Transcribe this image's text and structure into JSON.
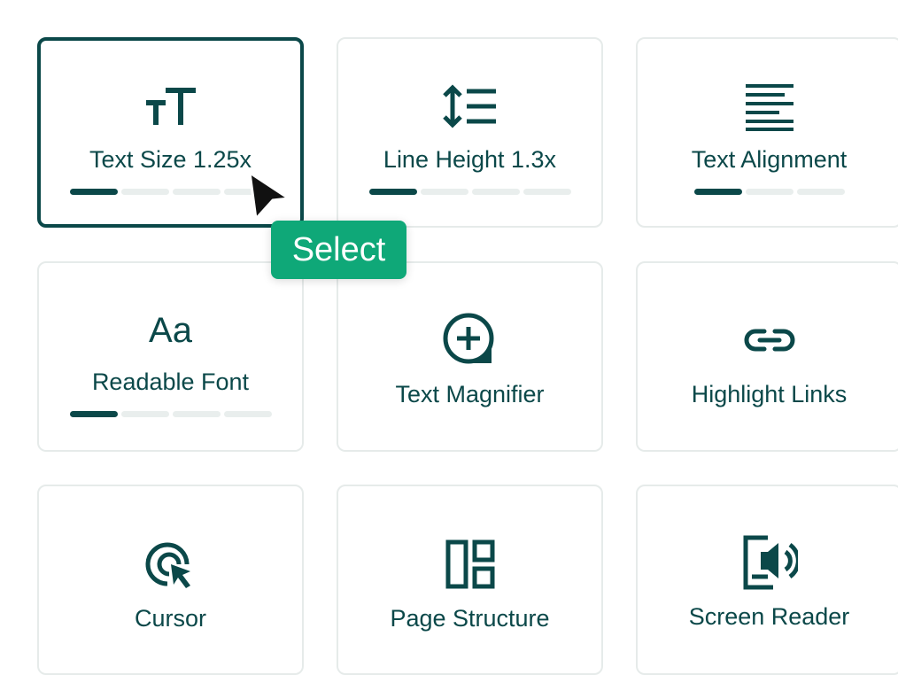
{
  "cards": [
    {
      "label": "Text Size 1.25x",
      "icon": "text-size-icon",
      "steps": 4,
      "level": 1,
      "active": true
    },
    {
      "label": "Line Height 1.3x",
      "icon": "line-height-icon",
      "steps": 4,
      "level": 1,
      "active": false
    },
    {
      "label": "Text Alignment",
      "icon": "text-align-icon",
      "steps": 3,
      "level": 1,
      "active": false
    },
    {
      "label": "Readable Font",
      "icon": "readable-font-icon",
      "steps": 4,
      "level": 1,
      "active": false
    },
    {
      "label": "Text Magnifier",
      "icon": "magnifier-icon",
      "steps": 0,
      "level": 0,
      "active": false
    },
    {
      "label": "Highlight Links",
      "icon": "link-icon",
      "steps": 0,
      "level": 0,
      "active": false
    },
    {
      "label": "Cursor",
      "icon": "cursor-icon",
      "steps": 0,
      "level": 0,
      "active": false
    },
    {
      "label": "Page Structure",
      "icon": "page-structure-icon",
      "steps": 0,
      "level": 0,
      "active": false
    },
    {
      "label": "Screen Reader",
      "icon": "screen-reader-icon",
      "steps": 0,
      "level": 0,
      "active": false
    }
  ],
  "tooltip": {
    "text": "Select"
  },
  "colors": {
    "accent": "#0b4849",
    "tooltip": "#0fa878",
    "border": "#e6ebea",
    "track": "#e9eeed"
  }
}
